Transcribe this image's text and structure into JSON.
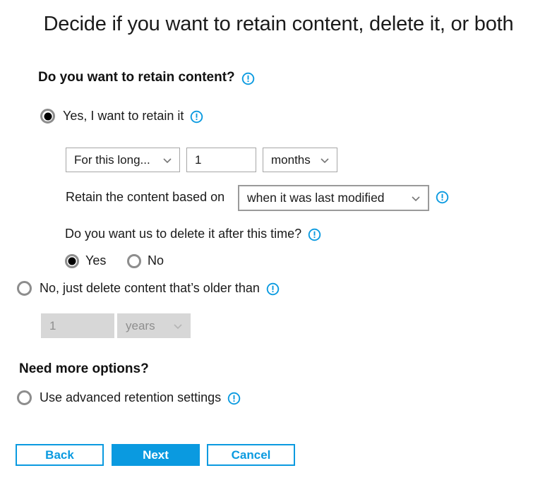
{
  "page": {
    "title": "Decide if you want to retain content, delete it, or both"
  },
  "retain_section": {
    "heading": "Do you want to retain content?",
    "options": {
      "retain_yes": "Yes, I want to retain it",
      "delete_older": "No, just delete content that’s older than"
    },
    "duration": {
      "type_value": "For this long...",
      "amount_value": "1",
      "unit_value": "months"
    },
    "based_on": {
      "label": "Retain the content based on",
      "value": "when it was last modified"
    },
    "delete_after": {
      "question": "Do you want us to delete it after this time?",
      "yes_label": "Yes",
      "no_label": "No"
    },
    "delete_older_inputs": {
      "amount_value": "1",
      "unit_value": "years"
    }
  },
  "advanced_section": {
    "heading": "Need more options?",
    "option_label": "Use advanced retention settings"
  },
  "footer": {
    "back_label": "Back",
    "next_label": "Next",
    "cancel_label": "Cancel"
  },
  "icons": {
    "info": "info-exclamation-icon",
    "chevron": "chevron-down-icon"
  },
  "colors": {
    "accent": "#0a9ae0",
    "border": "#a6a6a6",
    "disabled_bg": "#d7d7d7",
    "disabled_text": "#8e8e8e",
    "text": "#1a1a1a"
  }
}
